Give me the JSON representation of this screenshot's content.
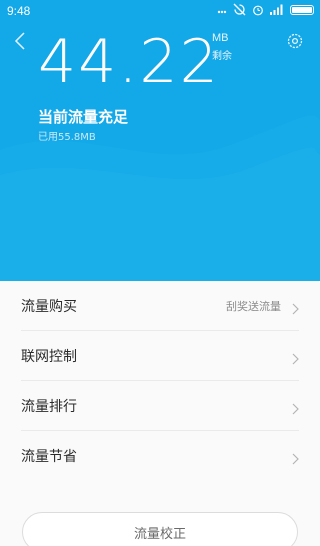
{
  "status_bar": {
    "time": "9:48",
    "icons": [
      "silent-icon",
      "sync-off-icon",
      "alarm-icon",
      "signal-icon",
      "battery-icon"
    ]
  },
  "header": {
    "back_icon": "chevron-left-icon",
    "settings_icon": "gear-icon",
    "remaining_value": "44.22",
    "unit": "MB",
    "remaining_label": "剩余",
    "status_title": "当前流量充足",
    "used_text": "已用55.8MB"
  },
  "list": {
    "items": [
      {
        "label": "流量购买",
        "extra": "刮奖送流量"
      },
      {
        "label": "联网控制",
        "extra": ""
      },
      {
        "label": "流量排行",
        "extra": ""
      },
      {
        "label": "流量节省",
        "extra": ""
      }
    ]
  },
  "footer": {
    "calibrate_label": "流量校正"
  },
  "colors": {
    "accent": "#13a8e8",
    "background": "#fafafa"
  }
}
